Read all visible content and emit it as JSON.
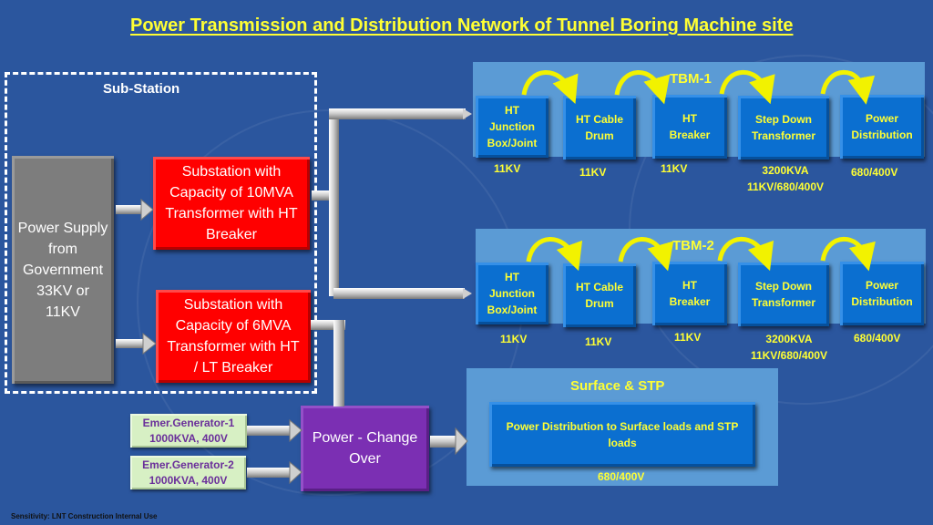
{
  "title": "Power Transmission and Distribution Network of Tunnel Boring Machine site",
  "substation": {
    "label": "Sub-Station",
    "source": "Power Supply from Government 33KV or 11KV",
    "unit1": "Substation with Capacity of 10MVA Transformer with HT Breaker",
    "unit2": "Substation with Capacity of 6MVA Transformer with HT / LT Breaker"
  },
  "tbm1": {
    "title": "TBM-1",
    "stages": [
      {
        "name": "HT Junction Box/Joint",
        "rating": "11KV"
      },
      {
        "name": "HT Cable Drum",
        "rating": "11KV"
      },
      {
        "name": "HT Breaker",
        "rating": "11KV"
      },
      {
        "name": "Step Down Transformer",
        "rating": "3200KVA 11KV/680/400V"
      },
      {
        "name": "Power Distribution",
        "rating": "680/400V"
      }
    ]
  },
  "tbm2": {
    "title": "TBM-2",
    "stages": [
      {
        "name": "HT Junction Box/Joint",
        "rating": "11KV"
      },
      {
        "name": "HT Cable Drum",
        "rating": "11KV"
      },
      {
        "name": "HT Breaker",
        "rating": "11KV"
      },
      {
        "name": "Step Down Transformer",
        "rating": "3200KVA 11KV/680/400V"
      },
      {
        "name": "Power Distribution",
        "rating": "680/400V"
      }
    ]
  },
  "surface": {
    "title": "Surface & STP",
    "box": "Power Distribution to Surface loads and STP loads",
    "rating": "680/400V"
  },
  "generators": [
    {
      "name": "Emer.Generator-1",
      "rating": "1000KVA, 400V"
    },
    {
      "name": "Emer.Generator-2",
      "rating": "1000KVA, 400V"
    }
  ],
  "changeover": "Power - Change Over",
  "footer": "Sensitivity: LNT Construction Internal Use",
  "colors": {
    "background": "#2b569e",
    "title": "#ffff33",
    "substation_box": "#ff0000",
    "source_box": "#7d7d7d",
    "stage_box": "#0b6fd0",
    "panel": "#5b9bd5",
    "generator_box": "#d7f0c4",
    "changeover_box": "#7b2fb3",
    "flow_arrow": "#f2f200"
  }
}
